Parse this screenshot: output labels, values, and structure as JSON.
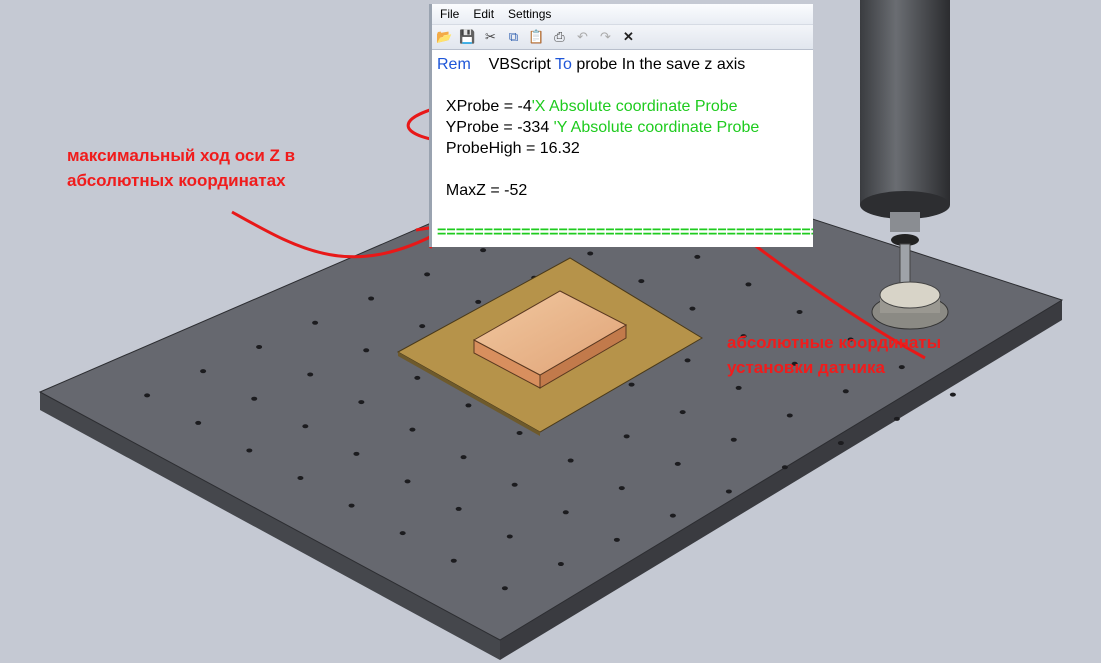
{
  "editor": {
    "menu": [
      "File",
      "Edit",
      "Settings"
    ],
    "toolbar_icons": [
      "open-folder-icon",
      "save-icon",
      "cut-icon",
      "copy-icon",
      "paste-icon",
      "print-icon",
      "undo-icon",
      "redo-icon",
      "close-icon"
    ],
    "lines": [
      {
        "kw1": "Rem",
        "t1": "    VBScript ",
        "kw2": "To",
        "t2": " probe In the save z axis"
      },
      {
        "code": "",
        "comment": ""
      },
      {
        "code": "  XProbe = -4",
        "comment": "'X Absolute coordinate Probe"
      },
      {
        "code": "  YProbe = -334 ",
        "comment": "'Y Absolute coordinate Probe"
      },
      {
        "code": "  ProbeHigh = 16.32",
        "comment": ""
      },
      {
        "code": "",
        "comment": ""
      },
      {
        "code": "  MaxZ = -52",
        "comment": ""
      },
      {
        "code": "",
        "comment": ""
      },
      {
        "code": "",
        "comment": "================================================"
      }
    ]
  },
  "annotations": {
    "left": [
      "максимальный ход оси Z в",
      "абсолютных координатах"
    ],
    "right": [
      "абсолютные координаты",
      "установки датчика"
    ]
  },
  "colors": {
    "annotation": "#f01c1c",
    "keyword": "#1e56d8",
    "comment": "#1ecb1e",
    "plate": "#5f6168"
  }
}
